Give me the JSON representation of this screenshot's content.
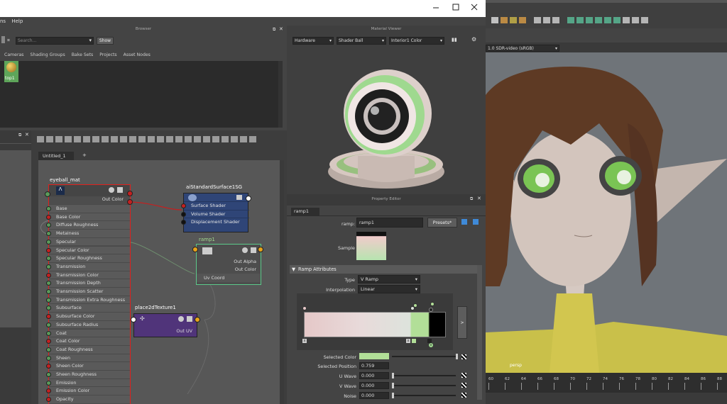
{
  "menubar": {
    "item1": "ns",
    "item2": "Help"
  },
  "browser": {
    "title": "Browser",
    "search_placeholder": "Search...",
    "show_label": "Show",
    "tabs": [
      "Cameras",
      "Shading Groups",
      "Bake Sets",
      "Projects",
      "Asset Nodes"
    ],
    "thumb_label": "top1"
  },
  "material_viewer": {
    "title": "Material Viewer",
    "renderer": "Hardware",
    "shape": "Shader Ball",
    "background": "Interior1 Color"
  },
  "viewport": {
    "colorspace": "1.0 SDR-video (sRGB)",
    "camera": "persp",
    "ruler": [
      "60",
      "62",
      "64",
      "66",
      "68",
      "70",
      "72",
      "74",
      "76",
      "78",
      "80",
      "82",
      "84",
      "86",
      "88"
    ]
  },
  "node_editor": {
    "tab": "Untitled_1",
    "add_tab": "+",
    "eyeball": {
      "name": "eyeball_mat",
      "out": "Out Color",
      "attrs": [
        "Base",
        "Base Color",
        "Diffuse Roughness",
        "Metalness",
        "Specular",
        "Specular Color",
        "Specular Roughness",
        "Transmission",
        "Transmission Color",
        "Transmission Depth",
        "Transmission Scatter",
        "Transmission Extra Roughness",
        "Subsurface",
        "Subsurface Color",
        "Subsurface Radius",
        "Coat",
        "Coat Color",
        "Coat Roughness",
        "Sheen",
        "Sheen Color",
        "Sheen Roughness",
        "Emission",
        "Emission Color",
        "Opacity"
      ]
    },
    "sg": {
      "name": "aiStandardSurface1SG",
      "attrs": [
        "Surface Shader",
        "Volume Shader",
        "Displacement Shader"
      ]
    },
    "ramp": {
      "name": "ramp1",
      "out_alpha": "Out Alpha",
      "out_color": "Out Color",
      "uv": "Uv Coord"
    },
    "place2d": {
      "name": "place2dTexture1",
      "out": "Out UV"
    }
  },
  "property_editor": {
    "title": "Property Editor",
    "tab": "ramp1",
    "ramp_label": "ramp:",
    "ramp_value": "ramp1",
    "presets": "Presets*",
    "sample_label": "Sample",
    "section": "Ramp Attributes",
    "type_label": "Type",
    "type_value": "V Ramp",
    "interp_label": "Interpolation",
    "interp_value": "Linear",
    "arrow_label": ">",
    "selected_color_label": "Selected Color",
    "selected_position_label": "Selected Position",
    "selected_position": "0.759",
    "u_wave_label": "U Wave",
    "u_wave": "0.000",
    "v_wave_label": "V Wave",
    "v_wave": "0.000",
    "noise_label": "Noise",
    "noise": "0.000"
  },
  "colors": {
    "accent": "#5bb24a",
    "eyeball_border": "#e0201c",
    "sg_body": "#2f4577",
    "ramp_border": "#5cc98a",
    "place2d_body": "#50347a",
    "iris": "#b6e29a"
  }
}
